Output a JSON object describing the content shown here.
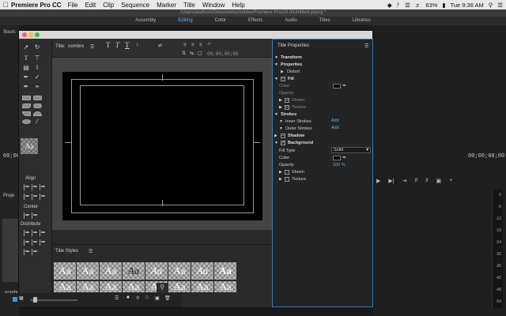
{
  "menubar": {
    "apple": "",
    "app_name": "Premiere Pro CC",
    "items": [
      "File",
      "Edit",
      "Clip",
      "Sequence",
      "Marker",
      "Title",
      "Window",
      "Help"
    ],
    "battery": "63%",
    "clock": "Tue 9:36 AM"
  },
  "app": {
    "project_path": "/Users/asafush/Documents/Adobe/Premiere Pro/10.0/Untitled.prproj *",
    "workspaces": [
      {
        "label": "Assembly",
        "active": false
      },
      {
        "label": "Editing",
        "active": true
      },
      {
        "label": "Color",
        "active": false
      },
      {
        "label": "Effects",
        "active": false
      },
      {
        "label": "Audio",
        "active": false
      },
      {
        "label": "Titles",
        "active": false
      },
      {
        "label": "Libraries",
        "active": false
      }
    ],
    "source_label": "Sourc",
    "left_timecode": "00;00",
    "right_timecode": "00;00;00;00",
    "project_label": "Proje",
    "project_item": "nombre",
    "meter_ticks": [
      "0",
      "-6",
      "-12",
      "-18",
      "-24",
      "-30",
      "-36",
      "-42",
      "-48",
      "-54"
    ]
  },
  "title_window": {
    "title_field_label": "Title:",
    "title_field_value": "nombre",
    "timecode": "00;00;00;00",
    "styles_label": "Title Styles",
    "align_label": "Align",
    "center_label": "Center",
    "distribute_label": "Distribute",
    "style_swatches_row1": [
      "Aa",
      "Aa",
      "Aa",
      "Aa",
      "Aa",
      "Aa",
      "Aa",
      "Aa"
    ],
    "style_swatches_row2": [
      "Aa",
      "Aa",
      "Aa",
      "Aa",
      "Aa",
      "Aa",
      "Aa",
      "Aa"
    ]
  },
  "properties": {
    "header": "Title Properties",
    "rows": {
      "transform": "Transform",
      "properties": "Properties",
      "distort": "Distort",
      "fill": "Fill",
      "color1": "Color",
      "opacity1": "Opacity",
      "sheen1": "Sheen",
      "texture1": "Texture",
      "strokes": "Strokes",
      "inner": "Inner Strokes",
      "outer": "Outer Strokes",
      "shadow": "Shadow",
      "background": "Background",
      "fill_type": "Fill Type",
      "color2": "Color",
      "opacity2": "Opacity",
      "sheen2": "Sheen",
      "texture2": "Texture"
    },
    "add_inner": "Add",
    "add_outer": "Add",
    "fill_type_value": "Solid",
    "opacity_value": "100 %"
  }
}
